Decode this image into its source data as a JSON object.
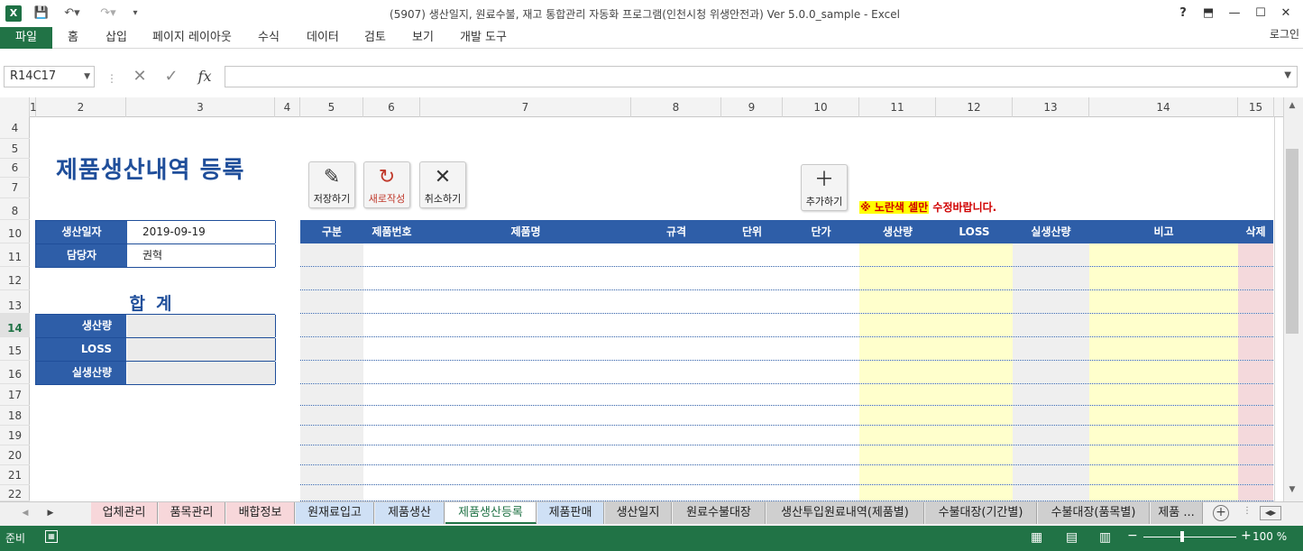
{
  "titlebar": {
    "app_icon": "X",
    "title": "(5907) 생산일지, 원료수불, 재고 통합관리 자동화 프로그램(인천시청 위생안전과) Ver 5.0.0_sample - Excel",
    "help": "?",
    "ribbon_opts": "⬒",
    "minimize": "—",
    "maximize": "☐",
    "close": "✕"
  },
  "ribbon": {
    "file_tab": "파일",
    "tabs": [
      "홈",
      "삽입",
      "페이지 레이아웃",
      "수식",
      "데이터",
      "검토",
      "보기",
      "개발 도구"
    ],
    "login": "로그인"
  },
  "formula_bar": {
    "name_box": "R14C17",
    "fx": "fx",
    "formula": ""
  },
  "columns": [
    "1",
    "2",
    "3",
    "4",
    "5",
    "6",
    "7",
    "8",
    "9",
    "10",
    "11",
    "12",
    "13",
    "14",
    "15"
  ],
  "rows": [
    "4",
    "5",
    "6",
    "7",
    "8",
    "10",
    "11",
    "12",
    "13",
    "14",
    "15",
    "16",
    "17",
    "18",
    "19",
    "20",
    "21",
    "22"
  ],
  "selected_row": "14",
  "sheet": {
    "title": "제품생산내역 등록",
    "buttons": {
      "save": "저장하기",
      "new": "새로작성",
      "cancel": "취소하기",
      "add": "추가하기"
    },
    "notice_prefix": "※ 노란색 셀만",
    "notice_suffix": " 수정바랍니다.",
    "info": {
      "date_label": "생산일자",
      "date_value": "2019-09-19",
      "manager_label": "담당자",
      "manager_value": "권혁"
    },
    "summary": {
      "title": "합계",
      "rows": [
        "생산량",
        "LOSS",
        "실생산량"
      ]
    },
    "table_headers": [
      "구분",
      "제품번호",
      "제품명",
      "규격",
      "단위",
      "단가",
      "생산량",
      "LOSS",
      "실생산량",
      "비고",
      "삭제"
    ]
  },
  "sheet_tabs": [
    "업체관리",
    "품목관리",
    "배합정보",
    "원재료입고",
    "제품생산",
    "제품생산등록",
    "제품판매",
    "생산일지",
    "원료수불대장",
    "생산투입원료내역(제품별)",
    "수불대장(기간별)",
    "수불대장(품목별)",
    "제품 ..."
  ],
  "active_tab": "제품생산등록",
  "status": {
    "ready": "준비",
    "zoom": "100 %"
  },
  "colors": {
    "excel_green": "#217346",
    "header_blue": "#2e5ea8",
    "title_blue": "#1f4e9a",
    "yellow_cell": "#ffffcc",
    "gray_cell": "#efefef",
    "pink_cell": "#f4d9dc",
    "notice_red": "#d00000"
  },
  "icons": {
    "save": "pencil-icon",
    "new": "refresh-icon",
    "cancel": "x-icon",
    "add": "plus-icon"
  }
}
